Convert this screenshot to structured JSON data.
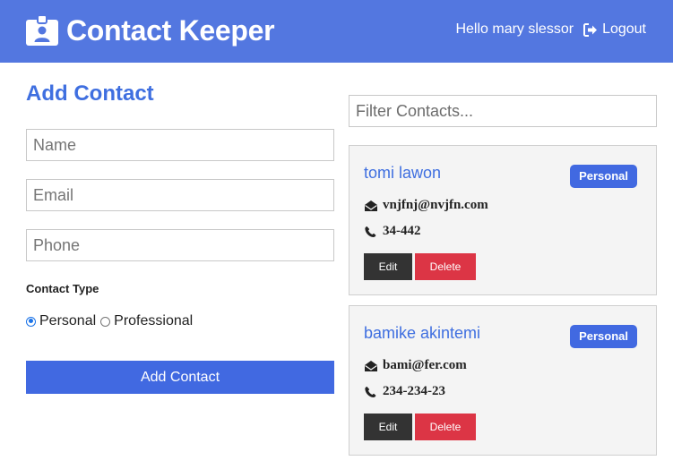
{
  "navbar": {
    "title": "Contact Keeper",
    "greeting": "Hello mary slessor",
    "logout_label": "Logout",
    "brand_icon": "id-badge-icon"
  },
  "form": {
    "heading": "Add Contact",
    "name_placeholder": "Name",
    "email_placeholder": "Email",
    "phone_placeholder": "Phone",
    "type_label": "Contact Type",
    "type_options": [
      "Personal",
      "Professional"
    ],
    "selected_type": "Personal",
    "submit_label": "Add Contact"
  },
  "filter": {
    "placeholder": "Filter Contacts..."
  },
  "contacts": [
    {
      "name": "tomi lawon",
      "type": "Personal",
      "email": "vnjfnj@nvjfn.com",
      "phone": "34-442",
      "edit_label": "Edit",
      "delete_label": "Delete"
    },
    {
      "name": "bamike akintemi",
      "type": "Personal",
      "email": "bami@fer.com",
      "phone": "234-234-23",
      "edit_label": "Edit",
      "delete_label": "Delete"
    }
  ],
  "colors": {
    "navbar": "#5377e0",
    "primary": "#4169e1",
    "heading": "#3f6fe0",
    "danger": "#dc3545",
    "dark": "#333333",
    "card_bg": "#f4f4f4"
  }
}
